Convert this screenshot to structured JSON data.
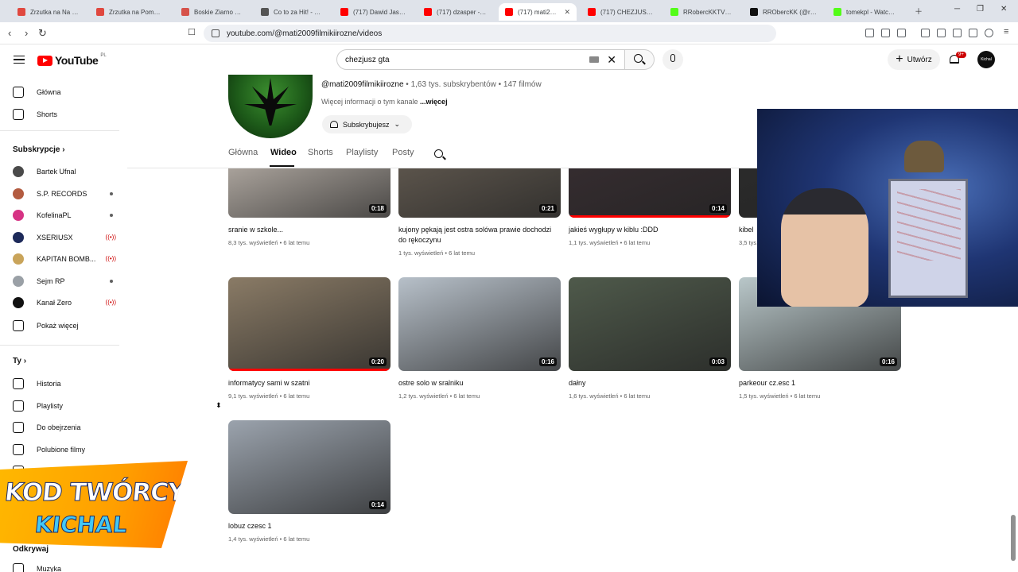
{
  "browser": {
    "tabs": [
      {
        "label": "Zrzutka na Na Chor",
        "color": "#e0483f"
      },
      {
        "label": "Zrzutka na Pomoc d",
        "color": "#e0483f"
      },
      {
        "label": "Boskie Ziarno 🌿 R",
        "color": "#d6524a"
      },
      {
        "label": "Co to za Hit! - Muz",
        "color": "#555555"
      },
      {
        "label": "(717) Dawid Jasper",
        "color": "#ff0000"
      },
      {
        "label": "(717) dzasper - You",
        "color": "#ff0000"
      },
      {
        "label": "(717) mati2009",
        "color": "#ff0000",
        "active": true
      },
      {
        "label": "(717) CHEZJUSZ GT",
        "color": "#ff0000"
      },
      {
        "label": "RRobercKKTV Strea",
        "color": "#53fc18"
      },
      {
        "label": "RRObercKK (@rr0b",
        "color": "#111111"
      },
      {
        "label": "tomekpl - Watch cli",
        "color": "#53fc18"
      }
    ],
    "url": "youtube.com/@mati2009filmikiirozne/videos"
  },
  "header": {
    "logo_word": "YouTube",
    "logo_country": "PL",
    "search_value": "chezjusz  gta",
    "create_label": "Utwórz",
    "notif_badge": "9+",
    "avatar_text": "Kichal"
  },
  "sidebar": {
    "main": [
      {
        "label": "Główna",
        "icon": "home-icon"
      },
      {
        "label": "Shorts",
        "icon": "shorts-icon"
      }
    ],
    "subs_title": "Subskrypcje",
    "subs": [
      {
        "label": "Bartek Ufnal",
        "color": "#4a4a4a",
        "status": ""
      },
      {
        "label": "S.P. RECORDS",
        "color": "#b35b40",
        "status": "dot"
      },
      {
        "label": "KofelinaPL",
        "color": "#d63384",
        "status": "dot"
      },
      {
        "label": "XSERIUSX",
        "color": "#1d2a5a",
        "status": "live"
      },
      {
        "label": "KAPITAN BOMB...",
        "color": "#c9a45a",
        "status": "live"
      },
      {
        "label": "Sejm RP",
        "color": "#9aa0a6",
        "status": "dot"
      },
      {
        "label": "Kanał Zero",
        "color": "#111111",
        "status": "live"
      }
    ],
    "show_more": "Pokaż więcej",
    "you_title": "Ty",
    "you": [
      {
        "label": "Historia",
        "icon": "history-icon"
      },
      {
        "label": "Playlisty",
        "icon": "playlists-icon"
      },
      {
        "label": "Do obejrzenia",
        "icon": "watch-later-icon"
      },
      {
        "label": "Polubione filmy",
        "icon": "like-icon"
      },
      {
        "label": "Twoje filmy",
        "icon": "your-videos-icon"
      }
    ],
    "explore_title": "Odkrywaj",
    "explore": [
      {
        "label": "Muzyka",
        "icon": "music-icon"
      }
    ]
  },
  "channel": {
    "handle": "@mati2009filmikiirozne",
    "stats": " • 1,63 tys. subskrybentów • 147 filmów",
    "more_text": "Więcej informacji o tym kanale ",
    "more_link": "...więcej",
    "subscribe_label": "Subskrybujesz",
    "tabs": [
      "Główna",
      "Wideo",
      "Shorts",
      "Playlisty",
      "Posty"
    ],
    "active_tab": "Wideo"
  },
  "videos": [
    {
      "title": "sranie w szkole...",
      "views": "8,3 tys. wyświetleń",
      "age": "6 lat temu",
      "duration": "0:18",
      "watched": false,
      "tone": "#cfc6bd"
    },
    {
      "title": "kujony pękają jest ostra solówa prawie dochodzi do rękoczynu",
      "views": "1 tys. wyświetleń",
      "age": "6 lat temu",
      "duration": "0:21",
      "watched": false,
      "tone": "#6b6257"
    },
    {
      "title": "jakieś wygłupy w kiblu :DDD",
      "views": "1,1 tys. wyświetleń",
      "age": "6 lat temu",
      "duration": "0:14",
      "watched": true,
      "tone": "#3a2f33"
    },
    {
      "title": "kibel",
      "views": "3,5 tys. wyświetleń",
      "age": "6 lat temu",
      "duration": "",
      "watched": false,
      "tone": "#2d2d2d"
    },
    {
      "title": "informatycy sami w szatni",
      "views": "9,1 tys. wyświetleń",
      "age": "6 lat temu",
      "duration": "0:20",
      "watched": true,
      "tone": "#8a7b66"
    },
    {
      "title": "ostre solo w sralniku",
      "views": "1,2 tys. wyświetleń",
      "age": "6 lat temu",
      "duration": "0:16",
      "watched": false,
      "tone": "#b7c0c9"
    },
    {
      "title": "dałny",
      "views": "1,6 tys. wyświetleń",
      "age": "6 lat temu",
      "duration": "0:03",
      "watched": false,
      "tone": "#4f5a4b"
    },
    {
      "title": "parkeour cz.esc 1",
      "views": "1,5 tys. wyświetleń",
      "age": "6 lat temu",
      "duration": "0:16",
      "watched": false,
      "tone": "#b9c7c9"
    },
    {
      "title": "lobuz czesc 1",
      "views": "1,4 tys. wyświetleń",
      "age": "6 lat temu",
      "duration": "0:14",
      "watched": false,
      "tone": "#9ba3ad"
    }
  ],
  "overlay": {
    "promo_line1": "KOD TWÓRCY",
    "promo_line2": "KICHAL"
  }
}
